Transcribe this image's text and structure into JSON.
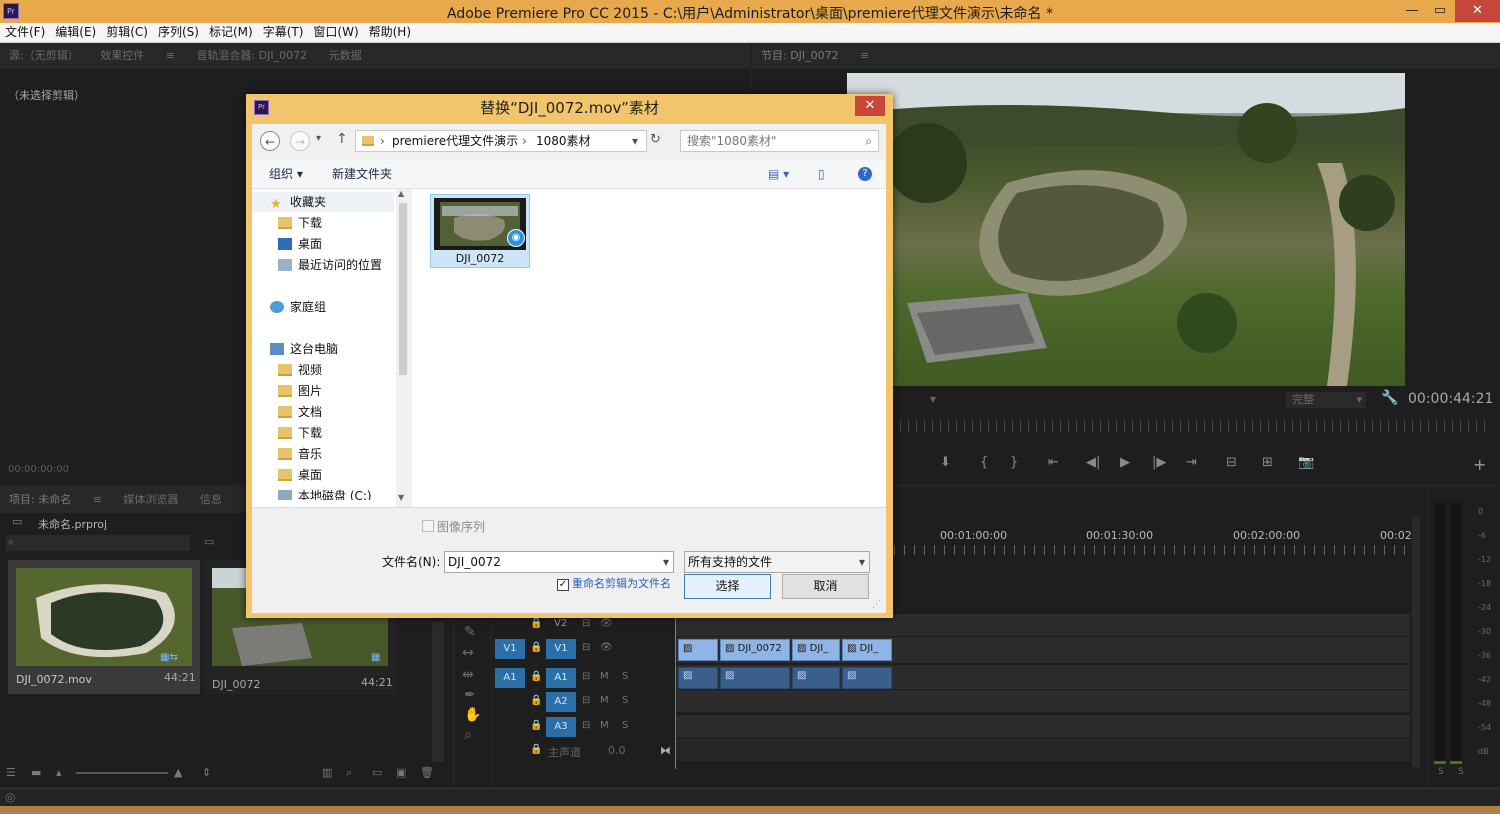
{
  "app": {
    "logo": "Pr",
    "title": "Adobe Premiere Pro CC 2015 - C:\\用户\\Administrator\\桌面\\premiere代理文件演示\\未命名 *",
    "win_min": "—",
    "win_max": "▭",
    "win_close": "✕"
  },
  "menu": [
    "文件(F)",
    "编辑(E)",
    "剪辑(C)",
    "序列(S)",
    "标记(M)",
    "字幕(T)",
    "窗口(W)",
    "帮助(H)"
  ],
  "source_panel": {
    "tabs": [
      "源:（无剪辑）",
      "效果控件",
      "音轨混合器: DJI_0072",
      "元数据"
    ],
    "no_clip": "（未选择剪辑）",
    "timecode": "00:00:00:00"
  },
  "program_panel": {
    "tab": "节目: DJI_0072",
    "quality": "完整",
    "timecode": "00:00:44:21"
  },
  "project_panel": {
    "tabs": [
      "项目: 未命名",
      "媒体浏览器",
      "信息"
    ],
    "project_file": "未命名.prproj",
    "items": [
      {
        "name": "DJI_0072.mov",
        "duration": "44:21"
      },
      {
        "name": "DJI_0072",
        "duration": "44:21"
      }
    ]
  },
  "timeline": {
    "ruler": [
      "00:01:00:00",
      "00:01:30:00",
      "00:02:00:00",
      "00:02"
    ],
    "tracks": {
      "v2": "V2",
      "v1_src": "V1",
      "v1": "V1",
      "a1_src": "A1",
      "a1": "A1",
      "a2": "A2",
      "a3": "A3",
      "master": "主声道",
      "master_val": "0.0",
      "m": "M",
      "s": "S"
    },
    "clips": [
      "DJI_0072",
      "DJI_",
      "DJI_"
    ]
  },
  "meter": {
    "scale": [
      "0",
      "-6",
      "-12",
      "-18",
      "-24",
      "-30",
      "-36",
      "-42",
      "-48",
      "-54",
      "dB"
    ],
    "solo": [
      "S",
      "S"
    ]
  },
  "dialog": {
    "title": "替换“DJI_0072.mov”素材",
    "close": "✕",
    "breadcrumb": [
      "premiere代理文件演示",
      "1080素材"
    ],
    "search_placeholder": "搜索\"1080素材\"",
    "organize": "组织 ▾",
    "new_folder": "新建文件夹",
    "help": "?",
    "tree": {
      "favorites": "收藏夹",
      "fav_items": [
        "下载",
        "桌面",
        "最近访问的位置"
      ],
      "homegroup": "家庭组",
      "this_pc": "这台电脑",
      "pc_items": [
        "视频",
        "图片",
        "文档",
        "下载",
        "音乐",
        "桌面",
        "本地磁盘 (C:)"
      ]
    },
    "file": {
      "name": "DJI_0072"
    },
    "image_sequence": "图像序列",
    "filename_label": "文件名(N):",
    "filename_value": "DJI_0072",
    "filter": "所有支持的文件",
    "rename_checkbox": "重命名剪辑为文件名",
    "select_button": "选择",
    "cancel_button": "取消"
  }
}
